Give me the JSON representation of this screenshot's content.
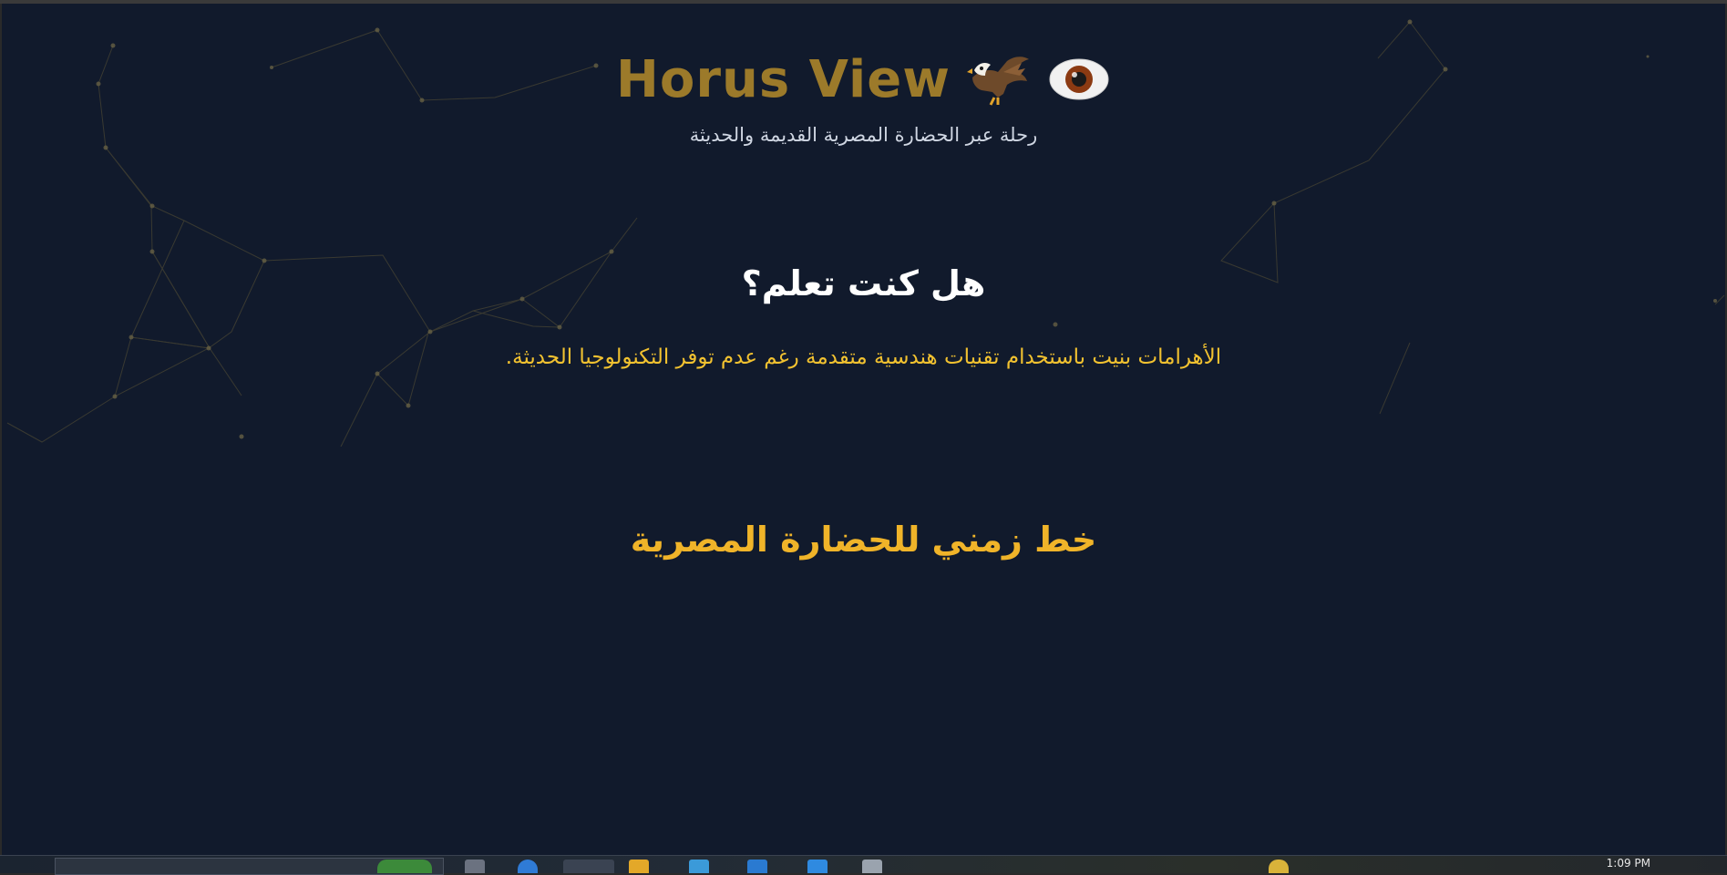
{
  "header": {
    "brand": "Horus View",
    "subtitle": "رحلة عبر الحضارة المصرية القديمة والحديثة",
    "icons": [
      "eagle-icon",
      "eye-icon"
    ]
  },
  "fact": {
    "title": "هل كنت تعلم؟",
    "text": "الأهرامات بنيت باستخدام تقنيات هندسية متقدمة رغم عدم توفر التكنولوجيا الحديثة."
  },
  "timeline": {
    "title": "خط زمني للحضارة المصرية"
  },
  "taskbar": {
    "clock": "1:09 PM"
  },
  "colors": {
    "background": "#111a2c",
    "brand": "#9c7a2a",
    "fact_text": "#f2c230",
    "timeline_title": "#f0b429"
  }
}
